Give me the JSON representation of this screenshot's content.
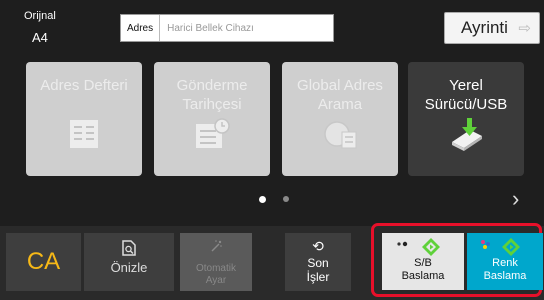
{
  "original": {
    "label": "Orijnal",
    "value": "A4"
  },
  "address": {
    "label": "Adres",
    "placeholder": "Harici Bellek Cihazı"
  },
  "detail_button": {
    "label": "Ayrinti"
  },
  "tiles": [
    {
      "label": "Adres Defteri",
      "enabled": false,
      "icon": "address-book-icon"
    },
    {
      "label": "Gönderme Tarihçesi",
      "enabled": false,
      "icon": "history-icon"
    },
    {
      "label": "Global Adres Arama",
      "enabled": false,
      "icon": "global-search-icon"
    },
    {
      "label": "Yerel Sürücü/USB",
      "enabled": true,
      "icon": "usb-drive-icon"
    }
  ],
  "pagination": {
    "current": 1,
    "total": 2
  },
  "bottom": {
    "ca": "CA",
    "preview": "Önizle",
    "auto_line1": "Otomatik",
    "auto_line2": "Ayar",
    "recent_line1": "Son",
    "recent_line2": "İşler",
    "bw_line1": "S/B",
    "bw_line2": "Baslama",
    "color_line1": "Renk",
    "color_line2": "Baslama"
  },
  "colors": {
    "ca": "#f6b817",
    "color_start": "#00a7cc",
    "highlight": "#e8102a",
    "start_icon": "#5fd13a"
  }
}
